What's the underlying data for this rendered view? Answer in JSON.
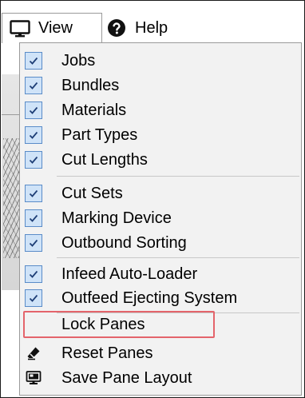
{
  "menubar": {
    "view": {
      "label": "View",
      "icon": "monitor-icon"
    },
    "help": {
      "label": "Help",
      "icon": "help-circle-icon"
    }
  },
  "view_menu": {
    "items": [
      {
        "label": "Jobs",
        "checked": true
      },
      {
        "label": "Bundles",
        "checked": true
      },
      {
        "label": "Materials",
        "checked": true
      },
      {
        "label": "Part Types",
        "checked": true
      },
      {
        "label": "Cut Lengths",
        "checked": true
      },
      {
        "label": "Cut Sets",
        "checked": true
      },
      {
        "label": "Marking Device",
        "checked": true
      },
      {
        "label": "Outbound Sorting",
        "checked": true
      },
      {
        "label": "Infeed Auto-Loader",
        "checked": true
      },
      {
        "label": "Outfeed Ejecting System",
        "checked": true
      },
      {
        "label": "Lock Panes",
        "checked": false,
        "highlighted": true
      },
      {
        "label": "Reset Panes",
        "icon": "eraser-icon"
      },
      {
        "label": "Save Pane Layout",
        "icon": "monitor-save-icon"
      }
    ]
  },
  "colors": {
    "check_fill": "#cfe3f8",
    "check_border": "#5a8cc8",
    "highlight_border": "#e4646b",
    "menu_bg": "#f2f2f2"
  }
}
